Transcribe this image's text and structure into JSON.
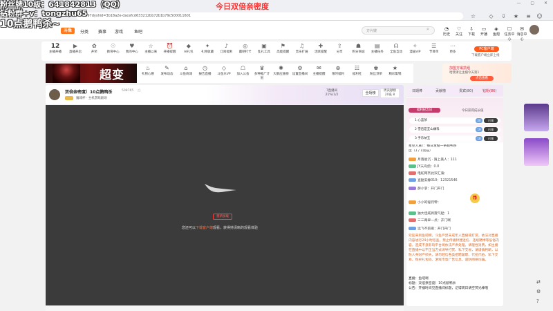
{
  "browser": {
    "url": "1597dyshid=3b18a2e-dacefcd633212bb72b1b79c500011601"
  },
  "overlay": {
    "line1": "粉丝牌10级：641842813（QQ）",
    "line2": "钻粉群+v：tongzhu65",
    "line3": "10点鹅鸭杀~",
    "title": "今日双倍亲密度"
  },
  "header": {
    "logo": "斗鱼",
    "nav": [
      "分类",
      "赛事",
      "游戏",
      "鱼吧"
    ],
    "search_placeholder": "方片嫂",
    "items": [
      {
        "label": "历史",
        "icon": "history-icon"
      },
      {
        "label": "关注",
        "icon": "heart-icon"
      },
      {
        "label": "下载",
        "icon": "download-icon"
      },
      {
        "label": "开播",
        "icon": "broadcast-icon"
      },
      {
        "label": "鱼翅",
        "icon": "fin-icon"
      },
      {
        "label": "任务中心",
        "icon": "task-icon"
      },
      {
        "label": "消息中心",
        "icon": "message-icon"
      }
    ]
  },
  "categories": {
    "count": "12",
    "count_label": "主播开播",
    "items": [
      "直播开启",
      "开奖",
      "教育中心",
      "我的中心",
      "主播以来",
      "开播提醒",
      "AI礼包",
      "礼物收藏",
      "订阅福利",
      "赢吧打卡",
      "乱礼工具",
      "高能提醒",
      "音乐扩展",
      "活跃提醒",
      "分享",
      "积分商城",
      "主播任务",
      "全鱼互动",
      "漫画VIP",
      "节目单",
      "更多"
    ],
    "pc_badge": "PC客户端",
    "pc_sub": "下载客户端立即上线"
  },
  "banner": {
    "text": "超变",
    "tools": [
      "礼物心愿",
      "发布动态",
      "斗鱼商城",
      "报告直播",
      "斗鱼水VP",
      "加入公会",
      "多种推广计划",
      "大鹅应援榜",
      "设置直播间",
      "主播提醒",
      "限时福利",
      "福利社",
      "粉丝顶单",
      "精彩集锦"
    ],
    "promo_title": "加盟方锻抗组",
    "promo_sub": "哈我请让主播今天第1",
    "promo_button": "点击查看"
  },
  "room": {
    "title": "双倍亲密度）10点鹅鸭杀",
    "id": "508765",
    "tag": "魔域杯  ·  主机游戏剧场",
    "stats": "7直播间\n21%/1/2",
    "action": "全场榜",
    "rank": "周贡献榜\n20名 8"
  },
  "player": {
    "refresh": "重新加载",
    "message_pre": "您还可以",
    "message_link": "下载客户端",
    "message_post": "观看，获得持清晰的观看体验"
  },
  "chat": {
    "tabs": [
      "日期棒",
      "贡献榜",
      "贵宾(80)",
      "钻粉(86)"
    ],
    "fan_title": "福利纪念日",
    "fan_sub": "今日获得成长值",
    "fan_rows": [
      {
        "label": "1  心蓝够",
        "lv": "20",
        "tag": "已领"
      },
      {
        "label": "2  雪后是互山斓科",
        "lv": "19",
        "tag": "已领"
      },
      {
        "label": "3  手乐纳五",
        "lv": "18",
        "tag": "已领"
      }
    ],
    "lines": [
      "星空人族）：每日发帖一条鹅鸭杀",
      "度（1 / 1完成）",
      "月落星沉 · 猜上美人：111",
      "JY天鸟鸽：0.0",
      "电蛇网奈此双汇藻：",
      "查勘安静010：12321546",
      "薛小李：开门开门",
      "小小的秘罚零：",
      "独大佳威到霓气起：1",
      "三三再翠一点：开门啊",
      "远飞不前夜：开门开门"
    ],
    "system_notice": "欢迎来到鱼吧啊，斗鱼严禁未成年人直播或打赏，依法对直播内容进行24小时巡查。禁止传播封建迷信、违规赌博等低俗内容，造成不良影响平台将依法严肃处理。请理性消费，如主播在直播中以不正当方式诱导打赏、私下交易，请谨慎判断，以防人身财产损失。请勿轻信各类招聘兼职、代抢代拍、私下交易、购买礼包码、游戏币等广告信息，谨防网络诈骗。",
    "info": [
      "直播：鱼吧啊",
      "标题：双倍亲密度）10点鹅鸭杀",
      "公告：开播时间见直播间标题，记得周日请空荧光棒哦"
    ]
  },
  "colors": {
    "brand": "#ff7a1a",
    "alert": "#ff2a2a",
    "player_bg": "#3b3b3b"
  }
}
